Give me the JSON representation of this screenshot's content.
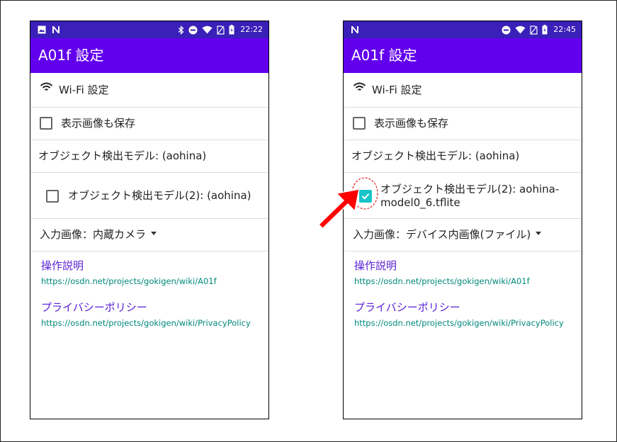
{
  "phones": {
    "left": {
      "status": {
        "time": "22:22",
        "left_icons": [
          "image-icon",
          "n-logo-icon"
        ],
        "right_icons": [
          "bluetooth-icon",
          "do-not-disturb-icon",
          "wifi-signal-icon",
          "no-sim-icon",
          "battery-icon"
        ]
      },
      "app_title": "A01f 設定",
      "wifi_label": "Wi-Fi 設定",
      "save_image_label": "表示画像も保存",
      "save_image_checked": false,
      "model_label": "オブジェクト検出モデル: (aohina)",
      "model2_label": "オブジェクト検出モデル(2): (aohina)",
      "model2_checked": false,
      "input_image_prefix": "入力画像：",
      "input_image_value": "内蔵カメラ",
      "manual_title": "操作説明",
      "manual_url": "https://osdn.net/projects/gokigen/wiki/A01f",
      "privacy_title": "プライバシーポリシー",
      "privacy_url": "https://osdn.net/projects/gokigen/wiki/PrivacyPolicy"
    },
    "right": {
      "status": {
        "time": "22:45",
        "left_icons": [
          "n-logo-icon"
        ],
        "right_icons": [
          "do-not-disturb-icon",
          "wifi-signal-icon",
          "no-sim-icon",
          "battery-icon"
        ]
      },
      "app_title": "A01f 設定",
      "wifi_label": "Wi-Fi 設定",
      "save_image_label": "表示画像も保存",
      "save_image_checked": false,
      "model_label": "オブジェクト検出モデル: (aohina)",
      "model2_label_line1": "オブジェクト検出モデル(2): aohina-",
      "model2_label_line2": "model0_6.tflite",
      "model2_checked": true,
      "input_image_prefix": "入力画像：",
      "input_image_value": "デバイス内画像(ファイル)",
      "manual_title": "操作説明",
      "manual_url": "https://osdn.net/projects/gokigen/wiki/A01f",
      "privacy_title": "プライバシーポリシー",
      "privacy_url": "https://osdn.net/projects/gokigen/wiki/PrivacyPolicy"
    }
  },
  "annotation": {
    "arrow_color": "#ff0000",
    "highlight_circle_color": "#e02020"
  },
  "colors": {
    "statusbar": "#3a1fb8",
    "appbar": "#6200ee",
    "checkbox_checked": "#19c4c8",
    "link_title": "#5a1fd6",
    "link_url": "#00897b"
  }
}
